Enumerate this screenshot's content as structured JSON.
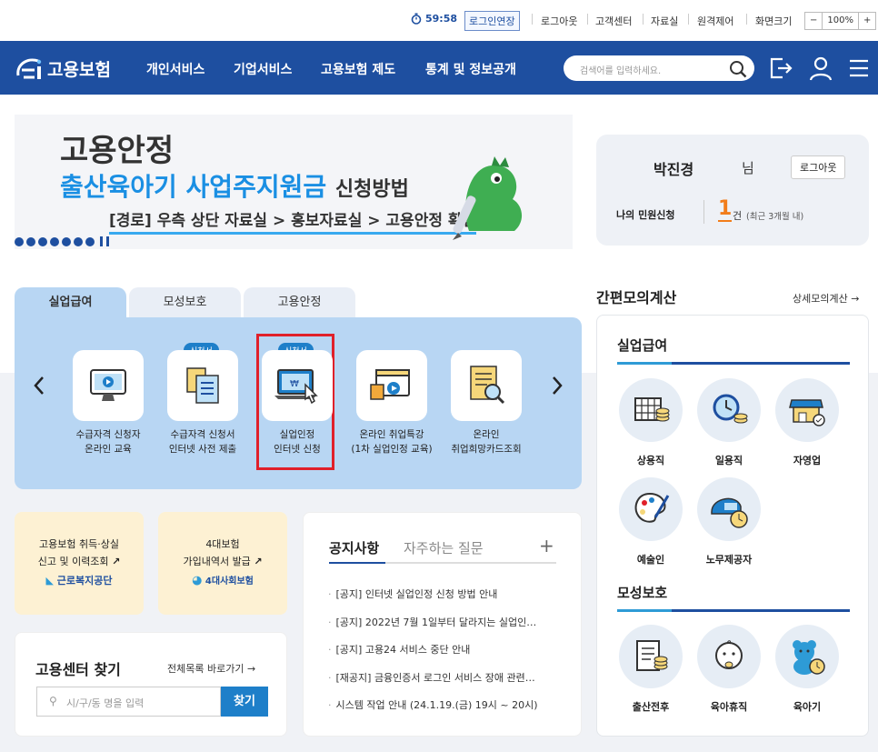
{
  "util": {
    "timer": "59:58",
    "extend_label": "로그인연장",
    "links": [
      "로그아웃",
      "고객센터",
      "자료실",
      "원격제어",
      "화면크기"
    ],
    "zoom": {
      "minus": "−",
      "value": "100%",
      "plus": "+"
    }
  },
  "nav": {
    "logo_text": "고용보험",
    "menu": [
      "개인서비스",
      "기업서비스",
      "고용보험 제도",
      "통계 및 정보공개"
    ],
    "search_placeholder": "검색어를 입력하세요."
  },
  "banner": {
    "line1": "고용안정",
    "line2": "출산육아기 사업주지원금",
    "line2_suffix": "신청방법",
    "line3": "[경로] 우측 상단 자료실 > 홍보자료실 > 고용안정 확인"
  },
  "user": {
    "name": "박진경",
    "suffix": "님",
    "logout": "로그아웃",
    "petition_label": "나의 민원신청",
    "count": "1",
    "count_unit": "건",
    "count_note": "(최근 3개월 내)"
  },
  "tabs": [
    "실업급여",
    "모성보호",
    "고용안정"
  ],
  "services": [
    {
      "label1": "수급자격 신청자",
      "label2": "온라인 교육",
      "badge": ""
    },
    {
      "label1": "수급자격 신청서",
      "label2": "인터넷 사전 제출",
      "badge": "신청서"
    },
    {
      "label1": "실업인정",
      "label2": "인터넷 신청",
      "badge": "신청서"
    },
    {
      "label1": "온라인 취업특강",
      "label2": "(1차 실업인정 교육)",
      "badge": ""
    },
    {
      "label1": "온라인",
      "label2": "취업희망카드조회",
      "badge": ""
    }
  ],
  "promo": [
    {
      "line1": "고용보험 취득·상실",
      "line2": "신고 및 이력조회",
      "org": "근로복지공단"
    },
    {
      "line1": "4대보험",
      "line2": "가입내역서 발급",
      "org": "4대사회보험"
    }
  ],
  "find_center": {
    "title": "고용센터 찾기",
    "link": "전체목록 바로가기 →",
    "placeholder": "시/구/동 명을 입력",
    "button": "찾기"
  },
  "notice": {
    "tab1": "공지사항",
    "tab2": "자주하는 질문",
    "plus": "+",
    "items": [
      "[공지] 인터넷 실업인정 신청 방법 안내",
      "[공지] 2022년 7월 1일부터 달라지는 실업인…",
      "[공지] 고용24 서비스 중단 안내",
      "[재공지] 금융인증서 로그인 서비스 장애 관련…",
      "시스템 작업 안내 (24.1.19.(금) 19시 ~ 20시)"
    ]
  },
  "calc": {
    "title": "간편모의계산",
    "detail_link": "상세모의계산 →",
    "section1": "실업급여",
    "items1": [
      "상용직",
      "일용직",
      "자영업",
      "예술인",
      "노무제공자"
    ],
    "section2": "모성보호",
    "items2": [
      "출산전후",
      "육아휴직",
      "육아기"
    ]
  },
  "colors": {
    "brand": "#1e4fa0",
    "accent": "#2e9bd6",
    "highlight": "#e0202a"
  }
}
